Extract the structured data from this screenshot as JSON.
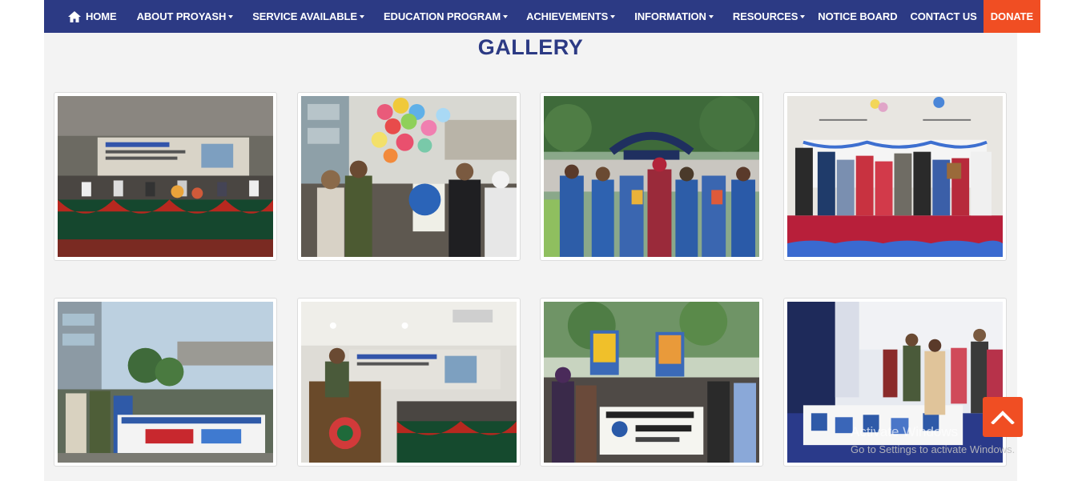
{
  "nav": {
    "home": "HOME",
    "about": "ABOUT PROYASH",
    "service": "SERVICE AVAILABLE",
    "education": "EDUCATION PROGRAM",
    "achievements": "ACHIEVEMENTS",
    "information": "INFORMATION",
    "resources": "RESOURCES",
    "notice": "NOTICE BOARD",
    "contact": "CONTACT US",
    "donate": "DONATE"
  },
  "icons": {
    "home": "home-icon",
    "dropdown": "chevron-down-icon",
    "scroll_top": "chevron-up-icon"
  },
  "colors": {
    "nav_bg": "#2c3a84",
    "accent": "#f04e23",
    "title": "#2c3a84",
    "page_bg": "#f3f3f3"
  },
  "gallery": {
    "title": "GALLERY",
    "photos": [
      {
        "scene": "seminar-stage-with-banner"
      },
      {
        "scene": "balloon-release-crowd"
      },
      {
        "scene": "children-at-gate"
      },
      {
        "scene": "children-stage-performance"
      },
      {
        "scene": "rally-with-banner"
      },
      {
        "scene": "speaker-at-podium"
      },
      {
        "scene": "banner-group-outdoor"
      },
      {
        "scene": "children-drawing-hall"
      }
    ]
  },
  "watermark": {
    "line1": "Activate Windows",
    "line2": "Go to Settings to activate Windows."
  }
}
